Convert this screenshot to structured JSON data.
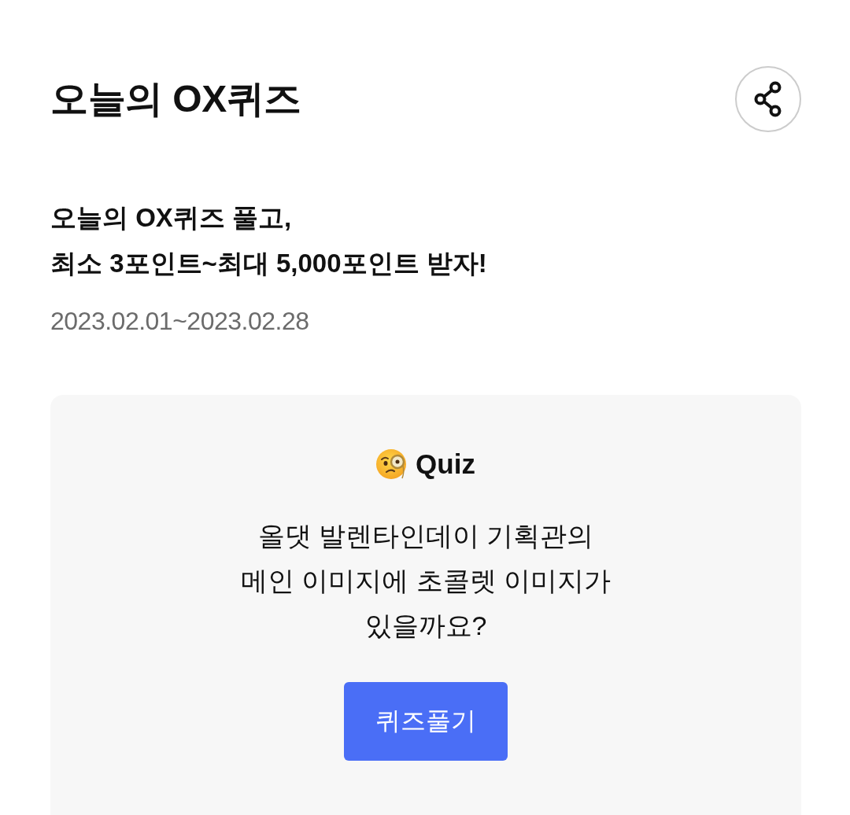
{
  "header": {
    "title": "오늘의 OX퀴즈"
  },
  "event": {
    "headline": [
      "오늘의 OX퀴즈 풀고,",
      "최소 3포인트~최대 5,000포인트 받자!"
    ],
    "period": "2023.02.01~2023.02.28"
  },
  "quiz_card": {
    "label": "Quiz",
    "question": [
      "올댓 발렌타인데이 기획관의",
      "메인 이미지에 초콜렛 이미지가",
      "있을까요?"
    ],
    "button": "퀴즈풀기"
  }
}
